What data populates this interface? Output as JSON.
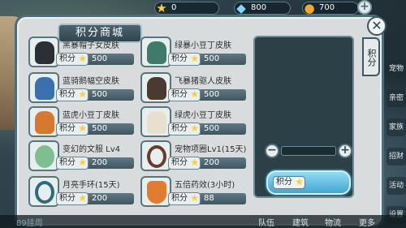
{
  "topbar": {
    "star_value": "0",
    "gem_value": "800",
    "coin_value": "700",
    "plus_icon": "plus-icon"
  },
  "panel": {
    "title": "积分商城",
    "close_icon": "close-icon",
    "side_tab": "积分"
  },
  "items": [
    {
      "name": "黑暴帽子女皮肤",
      "price_label": "积分",
      "price": "500"
    },
    {
      "name": "绿暴小豆丁皮肤",
      "price_label": "积分",
      "price": "500"
    },
    {
      "name": "蓝骑鹅幅空皮肤",
      "price_label": "积分",
      "price": "500"
    },
    {
      "name": "飞暴猪驱人皮肤",
      "price_label": "积分",
      "price": "500"
    },
    {
      "name": "蓝虎小豆丁皮肤",
      "price_label": "积分",
      "price": "500"
    },
    {
      "name": "绿虎小豆丁皮肤",
      "price_label": "积分",
      "price": "500"
    },
    {
      "name": "变幻的文服 Lv4",
      "price_label": "积分",
      "price": "200"
    },
    {
      "name": "宠物项圈Lv1(15天)",
      "price_label": "积分",
      "price": "200"
    },
    {
      "name": "月亮手环(15天)",
      "price_label": "积分",
      "price": "200"
    },
    {
      "name": "五倍药效(3小时)",
      "price_label": "积分",
      "price": "88"
    }
  ],
  "purchase": {
    "buy_label": "积分"
  },
  "edge_menu": [
    "宠物",
    "亲密",
    "家族",
    "招财",
    "活动",
    "设置"
  ],
  "bottom": {
    "left_text": "89挂周",
    "items": [
      "队伍",
      "建筑",
      "物流",
      "更多"
    ]
  },
  "colors": {
    "panel_bg": "#d9dcdd",
    "accent": "#4f6d78",
    "star": "#ffcf2b"
  }
}
